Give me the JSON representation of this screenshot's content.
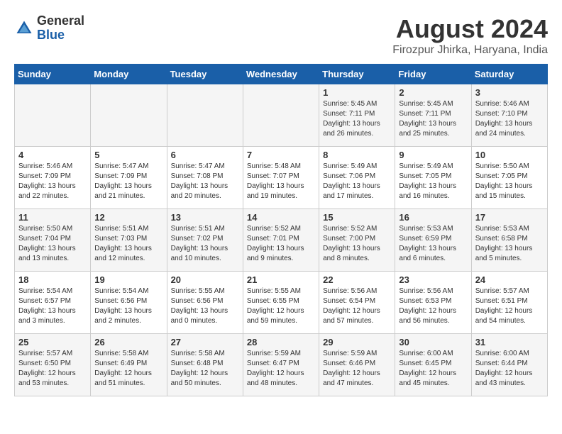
{
  "header": {
    "logo_general": "General",
    "logo_blue": "Blue",
    "month_year": "August 2024",
    "location": "Firozpur Jhirka, Haryana, India"
  },
  "weekdays": [
    "Sunday",
    "Monday",
    "Tuesday",
    "Wednesday",
    "Thursday",
    "Friday",
    "Saturday"
  ],
  "weeks": [
    [
      {
        "day": "",
        "info": ""
      },
      {
        "day": "",
        "info": ""
      },
      {
        "day": "",
        "info": ""
      },
      {
        "day": "",
        "info": ""
      },
      {
        "day": "1",
        "info": "Sunrise: 5:45 AM\nSunset: 7:11 PM\nDaylight: 13 hours\nand 26 minutes."
      },
      {
        "day": "2",
        "info": "Sunrise: 5:45 AM\nSunset: 7:11 PM\nDaylight: 13 hours\nand 25 minutes."
      },
      {
        "day": "3",
        "info": "Sunrise: 5:46 AM\nSunset: 7:10 PM\nDaylight: 13 hours\nand 24 minutes."
      }
    ],
    [
      {
        "day": "4",
        "info": "Sunrise: 5:46 AM\nSunset: 7:09 PM\nDaylight: 13 hours\nand 22 minutes."
      },
      {
        "day": "5",
        "info": "Sunrise: 5:47 AM\nSunset: 7:09 PM\nDaylight: 13 hours\nand 21 minutes."
      },
      {
        "day": "6",
        "info": "Sunrise: 5:47 AM\nSunset: 7:08 PM\nDaylight: 13 hours\nand 20 minutes."
      },
      {
        "day": "7",
        "info": "Sunrise: 5:48 AM\nSunset: 7:07 PM\nDaylight: 13 hours\nand 19 minutes."
      },
      {
        "day": "8",
        "info": "Sunrise: 5:49 AM\nSunset: 7:06 PM\nDaylight: 13 hours\nand 17 minutes."
      },
      {
        "day": "9",
        "info": "Sunrise: 5:49 AM\nSunset: 7:05 PM\nDaylight: 13 hours\nand 16 minutes."
      },
      {
        "day": "10",
        "info": "Sunrise: 5:50 AM\nSunset: 7:05 PM\nDaylight: 13 hours\nand 15 minutes."
      }
    ],
    [
      {
        "day": "11",
        "info": "Sunrise: 5:50 AM\nSunset: 7:04 PM\nDaylight: 13 hours\nand 13 minutes."
      },
      {
        "day": "12",
        "info": "Sunrise: 5:51 AM\nSunset: 7:03 PM\nDaylight: 13 hours\nand 12 minutes."
      },
      {
        "day": "13",
        "info": "Sunrise: 5:51 AM\nSunset: 7:02 PM\nDaylight: 13 hours\nand 10 minutes."
      },
      {
        "day": "14",
        "info": "Sunrise: 5:52 AM\nSunset: 7:01 PM\nDaylight: 13 hours\nand 9 minutes."
      },
      {
        "day": "15",
        "info": "Sunrise: 5:52 AM\nSunset: 7:00 PM\nDaylight: 13 hours\nand 8 minutes."
      },
      {
        "day": "16",
        "info": "Sunrise: 5:53 AM\nSunset: 6:59 PM\nDaylight: 13 hours\nand 6 minutes."
      },
      {
        "day": "17",
        "info": "Sunrise: 5:53 AM\nSunset: 6:58 PM\nDaylight: 13 hours\nand 5 minutes."
      }
    ],
    [
      {
        "day": "18",
        "info": "Sunrise: 5:54 AM\nSunset: 6:57 PM\nDaylight: 13 hours\nand 3 minutes."
      },
      {
        "day": "19",
        "info": "Sunrise: 5:54 AM\nSunset: 6:56 PM\nDaylight: 13 hours\nand 2 minutes."
      },
      {
        "day": "20",
        "info": "Sunrise: 5:55 AM\nSunset: 6:56 PM\nDaylight: 13 hours\nand 0 minutes."
      },
      {
        "day": "21",
        "info": "Sunrise: 5:55 AM\nSunset: 6:55 PM\nDaylight: 12 hours\nand 59 minutes."
      },
      {
        "day": "22",
        "info": "Sunrise: 5:56 AM\nSunset: 6:54 PM\nDaylight: 12 hours\nand 57 minutes."
      },
      {
        "day": "23",
        "info": "Sunrise: 5:56 AM\nSunset: 6:53 PM\nDaylight: 12 hours\nand 56 minutes."
      },
      {
        "day": "24",
        "info": "Sunrise: 5:57 AM\nSunset: 6:51 PM\nDaylight: 12 hours\nand 54 minutes."
      }
    ],
    [
      {
        "day": "25",
        "info": "Sunrise: 5:57 AM\nSunset: 6:50 PM\nDaylight: 12 hours\nand 53 minutes."
      },
      {
        "day": "26",
        "info": "Sunrise: 5:58 AM\nSunset: 6:49 PM\nDaylight: 12 hours\nand 51 minutes."
      },
      {
        "day": "27",
        "info": "Sunrise: 5:58 AM\nSunset: 6:48 PM\nDaylight: 12 hours\nand 50 minutes."
      },
      {
        "day": "28",
        "info": "Sunrise: 5:59 AM\nSunset: 6:47 PM\nDaylight: 12 hours\nand 48 minutes."
      },
      {
        "day": "29",
        "info": "Sunrise: 5:59 AM\nSunset: 6:46 PM\nDaylight: 12 hours\nand 47 minutes."
      },
      {
        "day": "30",
        "info": "Sunrise: 6:00 AM\nSunset: 6:45 PM\nDaylight: 12 hours\nand 45 minutes."
      },
      {
        "day": "31",
        "info": "Sunrise: 6:00 AM\nSunset: 6:44 PM\nDaylight: 12 hours\nand 43 minutes."
      }
    ]
  ]
}
